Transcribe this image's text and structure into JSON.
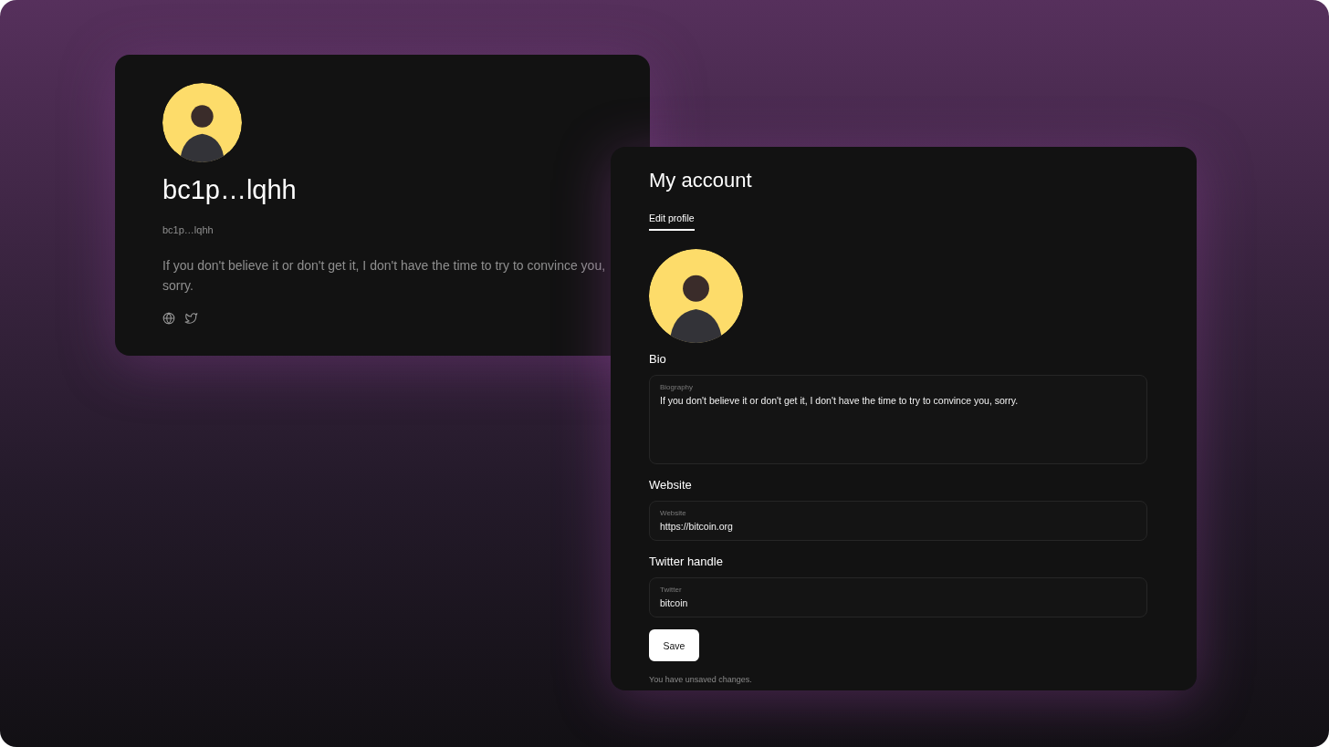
{
  "profile_card": {
    "display_name": "bc1p…lqhh",
    "handle": "bc1p…lqhh",
    "bio": "If you don't believe it or don't get it, I don't have the time to try to convince you, sorry.",
    "links": [
      {
        "kind": "website"
      },
      {
        "kind": "twitter"
      }
    ]
  },
  "account_card": {
    "title": "My account",
    "tabs": [
      {
        "label": "Edit profile",
        "selected": true
      }
    ],
    "sections": [
      {
        "heading": "Bio",
        "field": {
          "kind": "multiline",
          "label": "Biography",
          "value": "If you don't believe it or don't get it, I don't have the time to try to convince you, sorry."
        }
      },
      {
        "heading": "Website",
        "field": {
          "kind": "single",
          "label": "Website",
          "value": "https://bitcoin.org"
        }
      },
      {
        "heading": "Twitter handle",
        "field": {
          "kind": "single",
          "label": "Twitter",
          "value": "bitcoin"
        }
      }
    ],
    "save_button": "Save",
    "status": "You have unsaved changes."
  }
}
